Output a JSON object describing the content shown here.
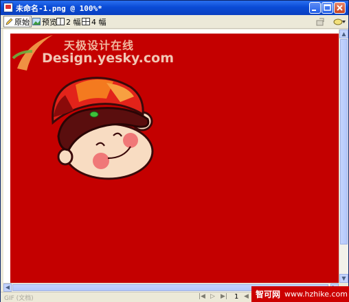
{
  "window": {
    "title": "未命名-1.png @ 100%*"
  },
  "toolbar": {
    "original_label": "原始",
    "preview_label": "预览",
    "two_up_label": "2 幅",
    "four_up_label": "4 幅"
  },
  "canvas": {
    "background_color": "#c40000"
  },
  "watermark": {
    "chinese": "天极设计在线",
    "url": "Design.yesky.com"
  },
  "statusbar": {
    "format": "GIF (文档)",
    "page": "1"
  },
  "corner_badge": {
    "name": "智可网",
    "url": "www.hzhike.com"
  },
  "colors": {
    "title_bar": "#0a4bd6",
    "canvas_red": "#c40000",
    "hat_red": "#e2231a",
    "hat_orange": "#f47a1f",
    "hair_dark": "#5a0e0e",
    "skin": "#f8dcc2",
    "cheek": "#f07878"
  }
}
